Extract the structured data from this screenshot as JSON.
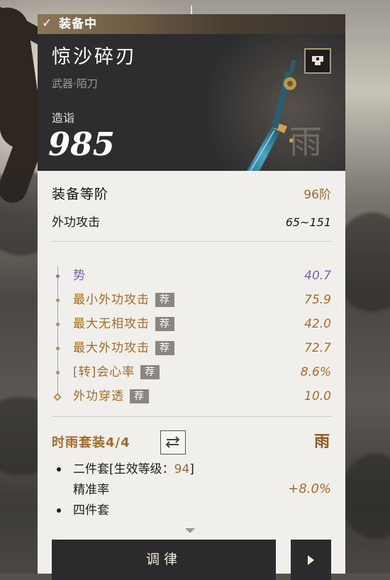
{
  "card": {
    "equipped_label": "装备中",
    "item_name": "惊沙碎刃",
    "item_type": "武器·陌刀",
    "score_label": "造诣",
    "score_value": "985",
    "set_mark": "雨"
  },
  "basics": {
    "grade_label": "装备等阶",
    "grade_value": "96阶",
    "attack_label": "外功攻击",
    "attack_value": "65~151"
  },
  "stats": [
    {
      "name": "势",
      "value": "40.7",
      "recommended": "",
      "color": "#7b5bb8"
    },
    {
      "name": "最小外功攻击",
      "value": "75.9",
      "recommended": "荐",
      "color": "#a26c2b"
    },
    {
      "name": "最大无相攻击",
      "value": "42.0",
      "recommended": "荐",
      "color": "#a26c2b"
    },
    {
      "name": "最大外功攻击",
      "value": "72.7",
      "recommended": "荐",
      "color": "#a26c2b"
    },
    {
      "name": "[转]会心率",
      "value": "8.6%",
      "recommended": "荐",
      "color": "#a26c2b"
    },
    {
      "name": "外功穿透",
      "value": "10.0",
      "recommended": "荐",
      "color": "#a26c2b"
    }
  ],
  "set": {
    "title": "时雨套装4/4",
    "icon": "雨",
    "two_piece_label": "二件套[生效等级：",
    "two_piece_level": "94",
    "two_piece_close": "]",
    "two_piece_stat": "精准率",
    "two_piece_value": "+8.0%",
    "four_piece_label": "四件套"
  },
  "actions": {
    "tune_label": "调律"
  },
  "colors": {
    "accent_gold": "#a26c2b",
    "purple": "#7b5bb8",
    "header_dark": "#2d2d2f",
    "panel_light": "#f1efec"
  }
}
